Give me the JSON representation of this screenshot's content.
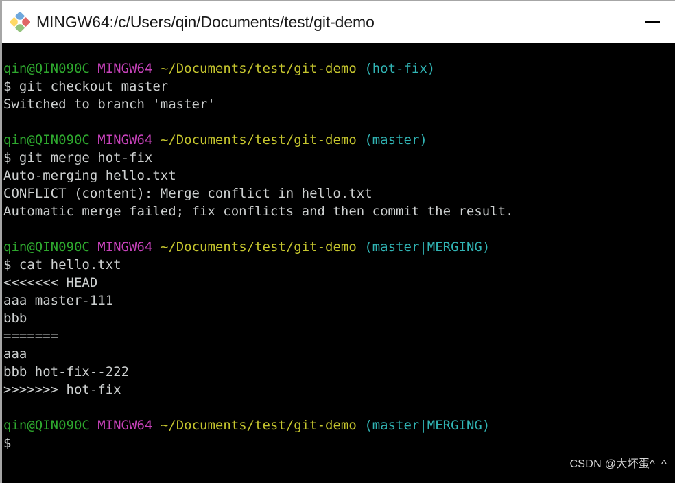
{
  "window": {
    "title": "MINGW64:/c/Users/qin/Documents/test/git-demo",
    "icon": "mingw-diamond-icon",
    "minimize_label": "—",
    "colors": {
      "titlebar_bg": "#ffffff",
      "titlebar_text": "#1a1a1a",
      "terminal_bg": "#000000",
      "border": "#a6a6a6"
    }
  },
  "terminal": {
    "colors": {
      "green": "#2ea82e",
      "magenta": "#c742ba",
      "yellow": "#c5c52e",
      "cyan": "#31b5b5",
      "white": "#cdd0d0"
    },
    "prompt": {
      "user_host": "qin@QIN090C",
      "shell": "MINGW64",
      "path": "~/Documents/test/git-demo"
    },
    "lines": [
      {
        "type": "prompt",
        "user_host": "qin@QIN090C",
        "shell": "MINGW64",
        "path": "~/Documents/test/git-demo",
        "branch": "(hot-fix)"
      },
      {
        "type": "command",
        "text": "$ git checkout master"
      },
      {
        "type": "output",
        "text": "Switched to branch 'master'"
      },
      {
        "type": "blank",
        "text": ""
      },
      {
        "type": "prompt",
        "user_host": "qin@QIN090C",
        "shell": "MINGW64",
        "path": "~/Documents/test/git-demo",
        "branch": "(master)"
      },
      {
        "type": "command",
        "text": "$ git merge hot-fix"
      },
      {
        "type": "output",
        "text": "Auto-merging hello.txt"
      },
      {
        "type": "output",
        "text": "CONFLICT (content): Merge conflict in hello.txt"
      },
      {
        "type": "output",
        "text": "Automatic merge failed; fix conflicts and then commit the result."
      },
      {
        "type": "blank",
        "text": ""
      },
      {
        "type": "prompt",
        "user_host": "qin@QIN090C",
        "shell": "MINGW64",
        "path": "~/Documents/test/git-demo",
        "branch": "(master|MERGING)"
      },
      {
        "type": "command",
        "text": "$ cat hello.txt"
      },
      {
        "type": "output",
        "text": "<<<<<<< HEAD"
      },
      {
        "type": "output",
        "text": "aaa master-111"
      },
      {
        "type": "output",
        "text": "bbb"
      },
      {
        "type": "output",
        "text": "======="
      },
      {
        "type": "output",
        "text": "aaa"
      },
      {
        "type": "output",
        "text": "bbb hot-fix--222"
      },
      {
        "type": "output",
        "text": ">>>>>>> hot-fix"
      },
      {
        "type": "blank",
        "text": ""
      },
      {
        "type": "prompt",
        "user_host": "qin@QIN090C",
        "shell": "MINGW64",
        "path": "~/Documents/test/git-demo",
        "branch": "(master|MERGING)"
      },
      {
        "type": "command",
        "text": "$"
      }
    ]
  },
  "watermark": {
    "text": "CSDN @大坏蛋^_^"
  }
}
